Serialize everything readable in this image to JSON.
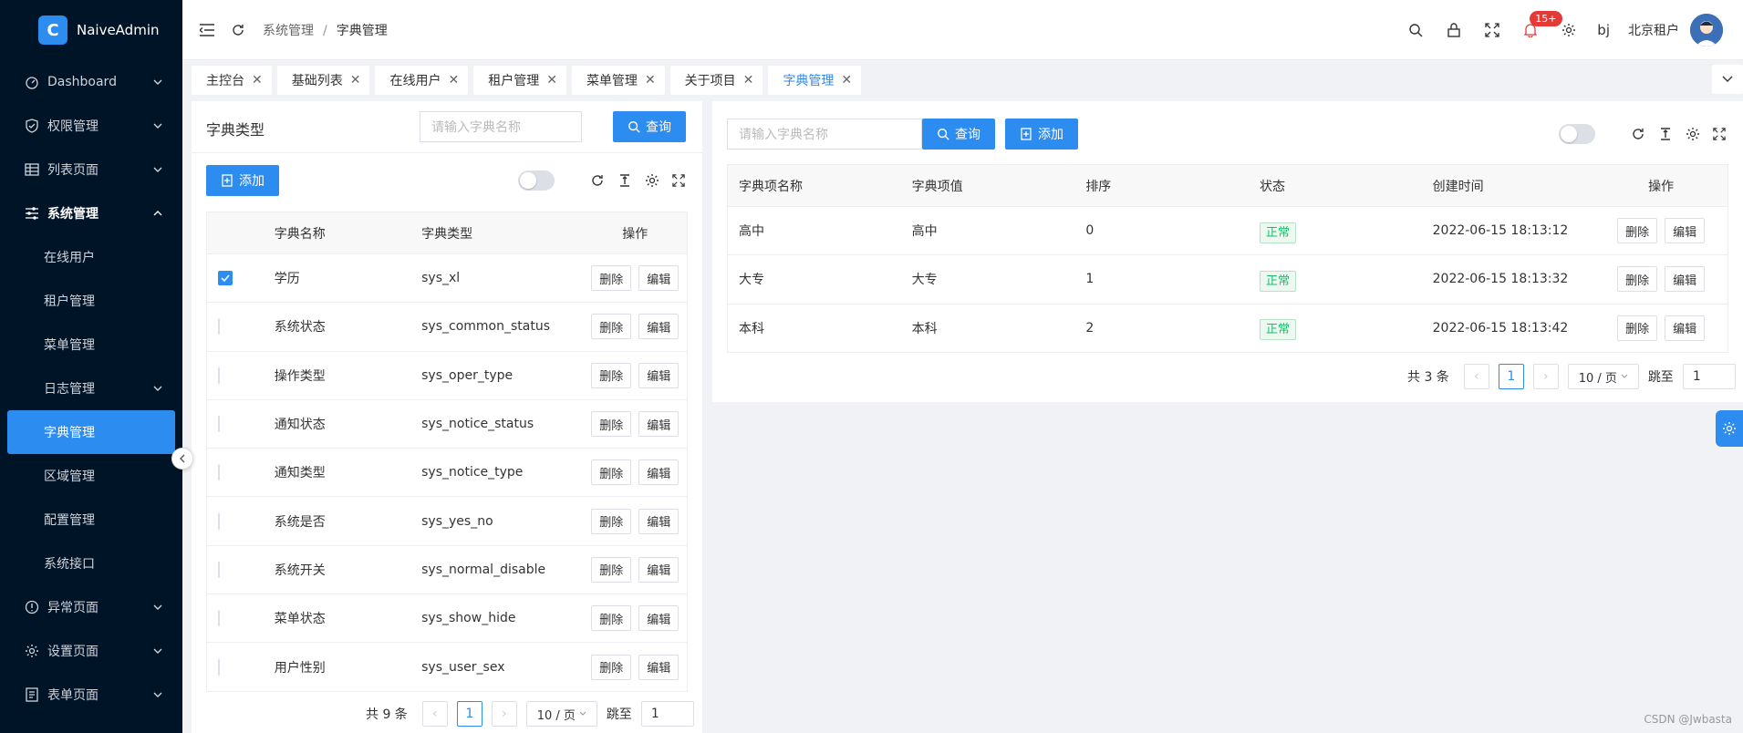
{
  "app": {
    "name": "NaiveAdmin"
  },
  "sidebar": {
    "items": [
      {
        "label": "Dashboard"
      },
      {
        "label": "权限管理"
      },
      {
        "label": "列表页面"
      },
      {
        "label": "系统管理"
      },
      {
        "label": "在线用户"
      },
      {
        "label": "租户管理"
      },
      {
        "label": "菜单管理"
      },
      {
        "label": "日志管理"
      },
      {
        "label": "字典管理"
      },
      {
        "label": "区域管理"
      },
      {
        "label": "配置管理"
      },
      {
        "label": "系统接口"
      },
      {
        "label": "异常页面"
      },
      {
        "label": "设置页面"
      },
      {
        "label": "表单页面"
      }
    ]
  },
  "header": {
    "breadcrumb": [
      "系统管理",
      "字典管理"
    ],
    "notice_badge": "15+",
    "lang": "bj",
    "tenant": "北京租户"
  },
  "tabs": [
    "主控台",
    "基础列表",
    "在线用户",
    "租户管理",
    "菜单管理",
    "关于项目",
    "字典管理"
  ],
  "left": {
    "title": "字典类型",
    "search_placeholder": "请输入字典名称",
    "query_label": "查询",
    "add_label": "添加",
    "columns": [
      "字典名称",
      "字典类型",
      "操作"
    ],
    "rows": [
      {
        "name": "学历",
        "type": "sys_xl",
        "checked": true
      },
      {
        "name": "系统状态",
        "type": "sys_common_status",
        "checked": false
      },
      {
        "name": "操作类型",
        "type": "sys_oper_type",
        "checked": false
      },
      {
        "name": "通知状态",
        "type": "sys_notice_status",
        "checked": false
      },
      {
        "name": "通知类型",
        "type": "sys_notice_type",
        "checked": false
      },
      {
        "name": "系统是否",
        "type": "sys_yes_no",
        "checked": false
      },
      {
        "name": "系统开关",
        "type": "sys_normal_disable",
        "checked": false
      },
      {
        "name": "菜单状态",
        "type": "sys_show_hide",
        "checked": false
      },
      {
        "name": "用户性别",
        "type": "sys_user_sex",
        "checked": false
      }
    ],
    "del_label": "删除",
    "edit_label": "编辑",
    "pager": {
      "total": "共 9 条",
      "page": "1",
      "size": "10 / 页",
      "jump_label": "跳至",
      "jump_value": "1"
    }
  },
  "right": {
    "search_placeholder": "请输入字典名称",
    "query_label": "查询",
    "add_label": "添加",
    "columns": [
      "字典项名称",
      "字典项值",
      "排序",
      "状态",
      "创建时间",
      "操作"
    ],
    "rows": [
      {
        "name": "高中",
        "value": "高中",
        "sort": "0",
        "status": "正常",
        "created": "2022-06-15 18:13:12"
      },
      {
        "name": "大专",
        "value": "大专",
        "sort": "1",
        "status": "正常",
        "created": "2022-06-15 18:13:32"
      },
      {
        "name": "本科",
        "value": "本科",
        "sort": "2",
        "status": "正常",
        "created": "2022-06-15 18:13:42"
      }
    ],
    "del_label": "删除",
    "edit_label": "编辑",
    "pager": {
      "total": "共 3 条",
      "page": "1",
      "size": "10 / 页",
      "jump_label": "跳至",
      "jump_value": "1"
    }
  },
  "watermark": "CSDN @Jwbasta"
}
